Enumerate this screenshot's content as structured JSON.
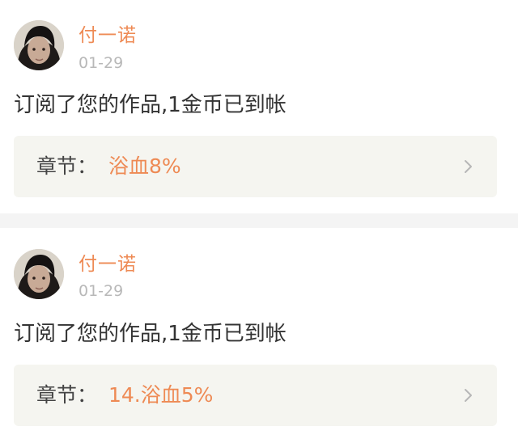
{
  "notifications": [
    {
      "username": "付一诺",
      "date": "01-29",
      "message": "订阅了您的作品,1金币已到帐",
      "chapter_label": "章节：",
      "chapter_title": "浴血8%",
      "avatar_icon": "user-avatar",
      "chevron_icon": "chevron-right-icon"
    },
    {
      "username": "付一诺",
      "date": "01-29",
      "message": "订阅了您的作品,1金币已到帐",
      "chapter_label": "章节：",
      "chapter_title": "14.浴血5%",
      "avatar_icon": "user-avatar",
      "chevron_icon": "chevron-right-icon"
    }
  ],
  "colors": {
    "accent": "#ee8a54",
    "text": "#333333",
    "muted": "#b8b8b8",
    "panel": "#f5f5f0",
    "separator": "#f4f4f4"
  }
}
